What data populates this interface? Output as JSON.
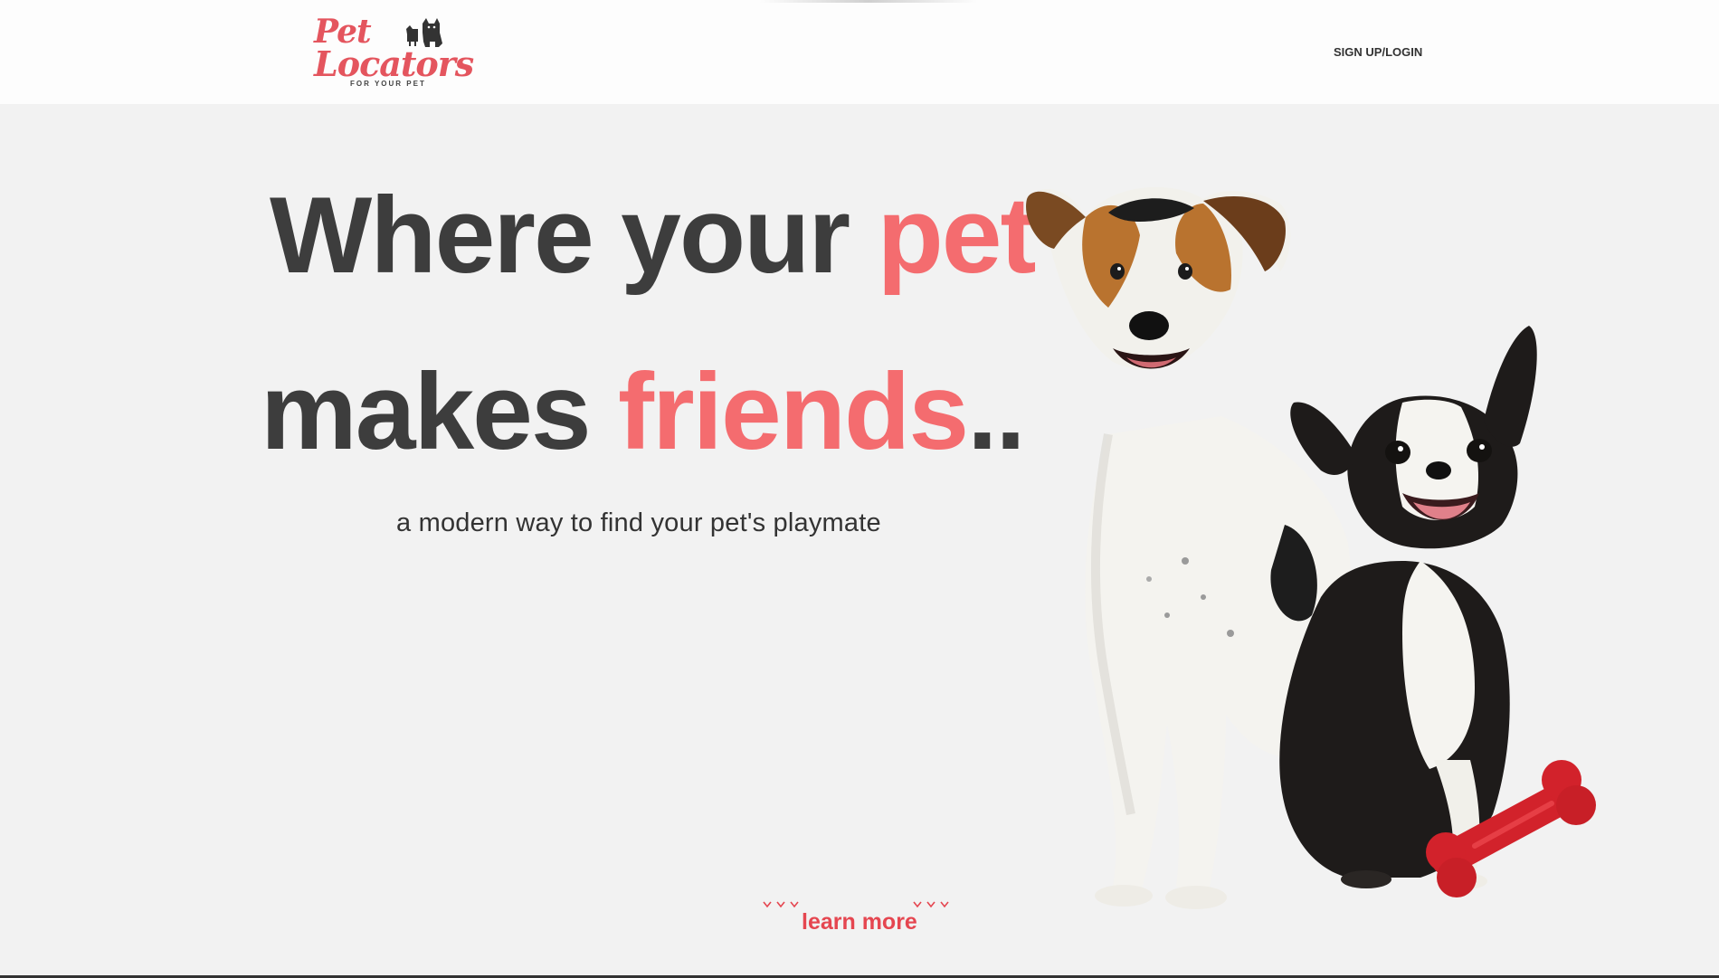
{
  "header": {
    "logo": {
      "line1": "Pet",
      "line2": "Locators",
      "tagline": "FOR YOUR PET"
    },
    "nav": {
      "signup_login": "SIGN UP/LOGIN"
    }
  },
  "hero": {
    "line1_prefix": "Where your ",
    "line1_accent": "pet",
    "line2_prefix": "makes ",
    "line2_accent": "friends",
    "line2_suffix": "..",
    "subtitle": "a modern way to find your pet's playmate"
  },
  "cta": {
    "learn_more": "learn more"
  },
  "colors": {
    "accent": "#f46c6f",
    "brand_red": "#e4555e",
    "heading": "#3d3d3d",
    "background": "#f2f2f2"
  },
  "icons": {
    "logo_pets": "cat-and-dog-silhouette-icon",
    "chevrons": "chevron-down-icon"
  }
}
